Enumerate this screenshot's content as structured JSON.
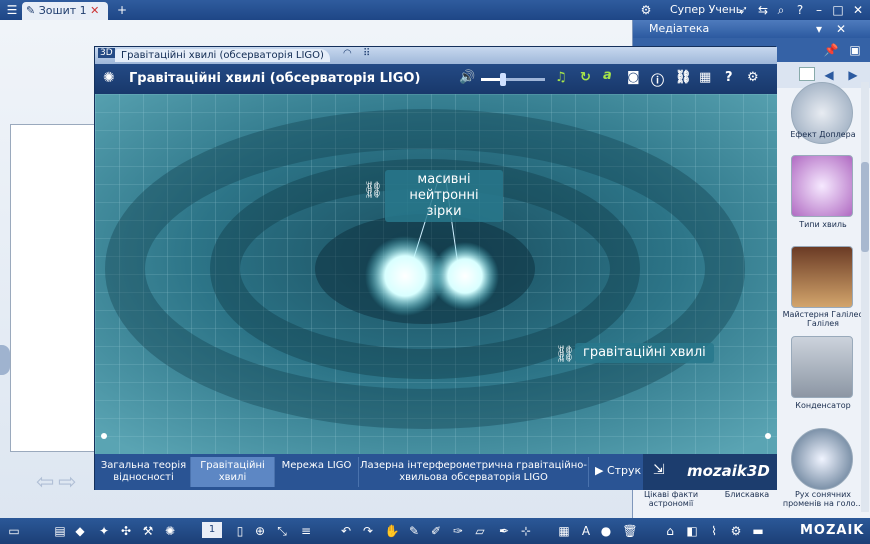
{
  "topbar": {
    "tab": "Зошит 1",
    "user": "Супер Учень"
  },
  "library": {
    "title": "Медіатека",
    "items": [
      {
        "label": "Ефект Доплера"
      },
      {
        "label": "Типи хвиль"
      },
      {
        "label": "Майстерня Галілео Галілея"
      },
      {
        "label": "Конденсатор"
      },
      {
        "label": "Рух сонячних променів на голо..."
      }
    ],
    "bottom_left": "Цікаві факти астрономії",
    "bottom_mid": "Блискавка"
  },
  "window": {
    "tab_title": "Гравітаційні хвилі (обсерваторія LIGO)",
    "app_title": "Гравітаційні хвилі (обсерваторія LIGO)",
    "badge": "3D",
    "volume": 0.35
  },
  "scene": {
    "label1": "масивні нейтронні зірки",
    "label2": "гравітаційні хвилі"
  },
  "tabs": [
    {
      "label": "Загальна теорія відносності",
      "active": false
    },
    {
      "label": "Гравітаційні хвилі",
      "active": true
    },
    {
      "label": "Мережа LIGO",
      "active": false
    },
    {
      "label": "Лазерна інтерферометрична гравітаційно-хвильова обсерваторія LIGO",
      "active": false
    }
  ],
  "next_label": "Струк",
  "brand": "mozaik3D",
  "taskbar": {
    "page_number": "1",
    "logo": "MOZAIK"
  }
}
